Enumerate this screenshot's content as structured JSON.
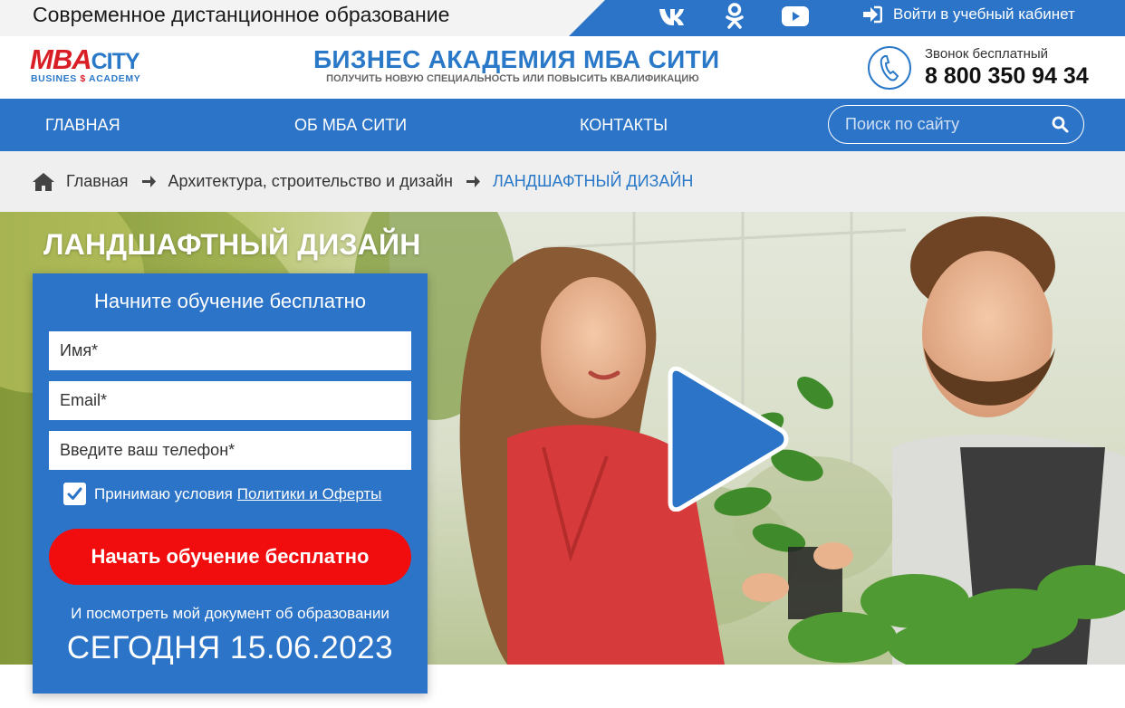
{
  "topbar": {
    "tagline": "Современное дистанционное образование",
    "socials": [
      {
        "name": "vk-icon"
      },
      {
        "name": "odnoklassniki-icon"
      },
      {
        "name": "youtube-icon"
      }
    ],
    "login_label": "Войти в учебный кабинет"
  },
  "header": {
    "logo_main": "MBA",
    "logo_city": "CITY",
    "logo_sub_left": "BUSINES",
    "logo_sub_right": "ACADEMY",
    "brand_title": "БИЗНЕС АКАДЕМИЯ МБА СИТИ",
    "brand_subtitle": "ПОЛУЧИТЬ НОВУЮ СПЕЦИАЛЬНОСТЬ ИЛИ ПОВЫСИТЬ КВАЛИФИКАЦИЮ",
    "phone_label": "Звонок бесплатный",
    "phone_number": "8 800 350 94 34"
  },
  "nav": {
    "items": [
      {
        "label": "ГЛАВНАЯ"
      },
      {
        "label": "ОБ МБА СИТИ"
      },
      {
        "label": "КОНТАКТЫ"
      }
    ],
    "search_placeholder": "Поиск по сайту"
  },
  "breadcrumb": {
    "items": [
      {
        "label": "Главная"
      },
      {
        "label": "Архитектура, строительство и дизайн"
      }
    ],
    "current": "ЛАНДШАФТНЫЙ ДИЗАЙН"
  },
  "hero": {
    "title": "ЛАНДШАФТНЫЙ ДИЗАЙН"
  },
  "form": {
    "title": "Начните обучение бесплатно",
    "name_placeholder": "Имя*",
    "email_placeholder": "Email*",
    "phone_placeholder": "Введите ваш телефон*",
    "agree_text": "Принимаю условия",
    "agree_link": "Политики и Оферты",
    "agree_checked": true,
    "submit_label": "Начать обучение бесплатно",
    "note": "И посмотреть мой документ об образовании",
    "date_line": "СЕГОДНЯ 15.06.2023"
  },
  "colors": {
    "primary_blue": "#2c74c7",
    "cta_red": "#f10d0d",
    "logo_red": "#d81f26",
    "breadcrumb_bg": "#efefef"
  }
}
